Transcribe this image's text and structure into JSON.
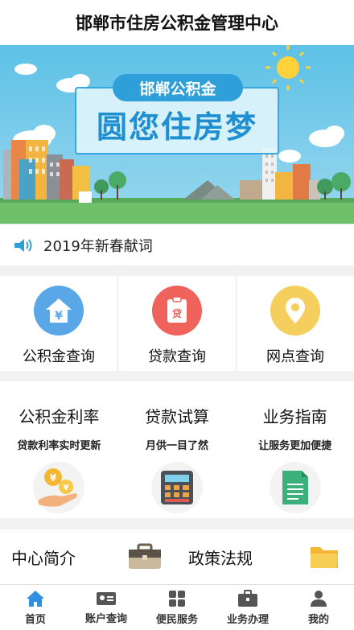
{
  "header": {
    "title": "邯郸市住房公积金管理中心"
  },
  "banner": {
    "pill_text": "邯郸公积金",
    "slogan": "圆您住房梦"
  },
  "notice": {
    "text": "2019年新春献词"
  },
  "quick_actions": [
    {
      "label": "公积金查询",
      "icon": "house-yen-icon",
      "color": "#5aa7e8"
    },
    {
      "label": "贷款查询",
      "icon": "loan-document-icon",
      "color": "#f0625c"
    },
    {
      "label": "网点查询",
      "icon": "location-pin-icon",
      "color": "#f5cf5e"
    }
  ],
  "tools": [
    {
      "title": "公积金利率",
      "subtitle": "贷款利率实时更新",
      "icon": "coins-hand-icon"
    },
    {
      "title": "贷款试算",
      "subtitle": "月供一目了然",
      "icon": "calculator-icon"
    },
    {
      "title": "业务指南",
      "subtitle": "让服务更加便捷",
      "icon": "document-icon"
    }
  ],
  "info": [
    {
      "label": "中心简介",
      "icon": "briefcase-icon"
    },
    {
      "label": "政策法规",
      "icon": "folder-icon"
    }
  ],
  "tabbar": [
    {
      "label": "首页",
      "icon": "home-icon",
      "active": true
    },
    {
      "label": "账户查询",
      "icon": "id-card-icon",
      "active": false
    },
    {
      "label": "便民服务",
      "icon": "grid-icon",
      "active": false
    },
    {
      "label": "业务办理",
      "icon": "toolbox-icon",
      "active": false
    },
    {
      "label": "我的",
      "icon": "person-icon",
      "active": false
    }
  ],
  "colors": {
    "accent": "#2e9fd8",
    "active_tab": "#2f8fe0"
  }
}
